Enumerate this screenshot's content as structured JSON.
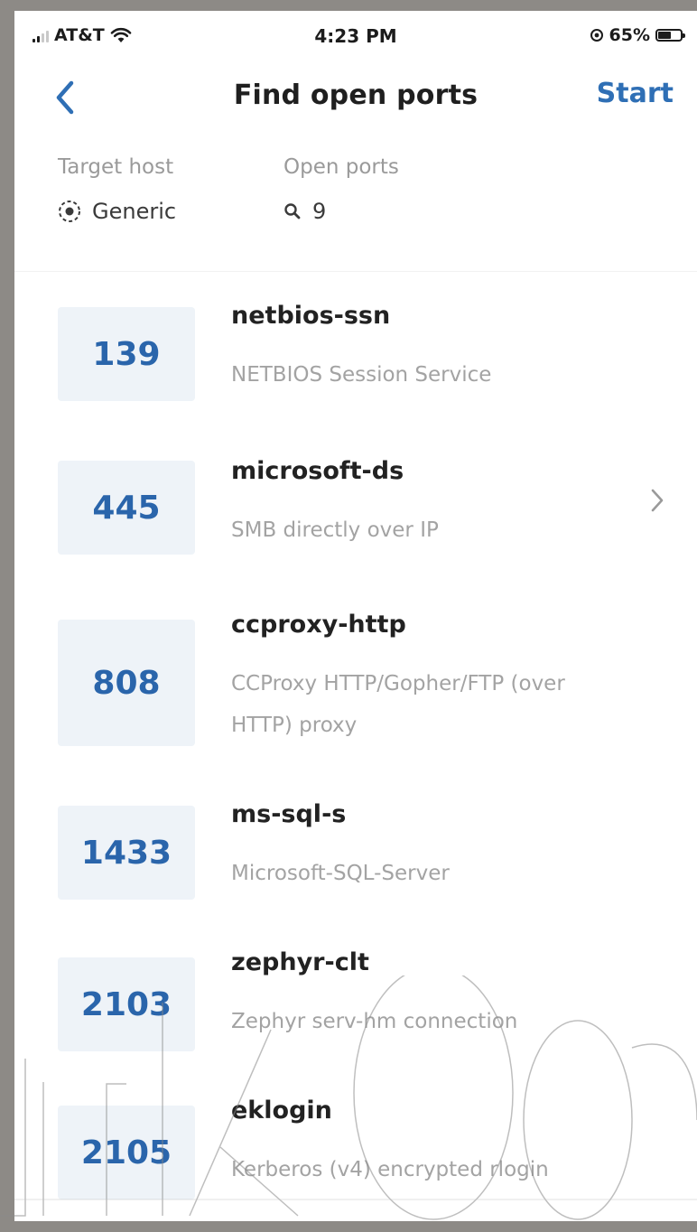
{
  "status_bar": {
    "carrier": "AT&T",
    "time": "4:23 PM",
    "battery": "65%",
    "battery_level": 0.65
  },
  "nav": {
    "title": "Find open ports",
    "start_label": "Start"
  },
  "summary": {
    "target_host_label": "Target host",
    "target_host_value": "Generic",
    "open_ports_label": "Open ports",
    "open_ports_value": "9"
  },
  "ports": [
    {
      "port": "139",
      "name": "netbios-ssn",
      "desc": "NETBIOS Session Service"
    },
    {
      "port": "445",
      "name": "microsoft-ds",
      "desc": "SMB directly over IP",
      "chevron": true
    },
    {
      "port": "808",
      "name": "ccproxy-http",
      "desc": "CCProxy HTTP/Gopher/FTP (over HTTP) proxy"
    },
    {
      "port": "1433",
      "name": "ms-sql-s",
      "desc": "Microsoft-SQL-Server"
    },
    {
      "port": "2103",
      "name": "zephyr-clt",
      "desc": "Zephyr serv-hm connection"
    },
    {
      "port": "2105",
      "name": "eklogin",
      "desc": "Kerberos (v4) encrypted rlogin"
    }
  ],
  "colors": {
    "accent": "#2f6fb5",
    "port_number": "#2a65ab",
    "port_box_bg": "#eef3f8"
  },
  "icons": {
    "back": "chevron-left-icon",
    "target": "radio-target-icon",
    "search": "search-icon",
    "row_chevron": "chevron-right-icon",
    "wifi": "wifi-icon",
    "location": "location-icon",
    "battery": "battery-icon"
  }
}
